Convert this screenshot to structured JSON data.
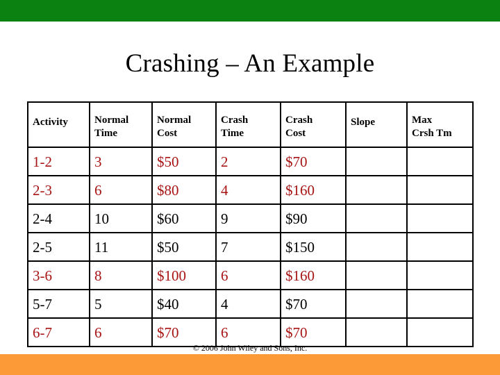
{
  "slide": {
    "title": "Crashing – An Example",
    "copyright": "© 2006 John Wiley and Sons, Inc.",
    "colors": {
      "top_bar": "#0a8111",
      "bottom_bar": "#fd9a38",
      "highlight_text": "#a81414",
      "normal_text": "#000000",
      "background": "#ffffff"
    }
  },
  "table": {
    "headers": [
      {
        "line1": "Activity",
        "line2": "",
        "style": "one-line"
      },
      {
        "line1": "Normal",
        "line2": "Time",
        "style": "two-line"
      },
      {
        "line1": "Normal",
        "line2": "Cost",
        "style": "two-line"
      },
      {
        "line1": "Crash",
        "line2": "Time",
        "style": "two-line"
      },
      {
        "line1": "Crash",
        "line2": "Cost",
        "style": "two-line"
      },
      {
        "line1": "Slope",
        "line2": "",
        "style": "one-line"
      },
      {
        "line1": "Max",
        "line2": "Crsh Tm",
        "style": "two-line"
      }
    ],
    "rows": [
      {
        "activity": "1-2",
        "normal_time": "3",
        "normal_cost": "$50",
        "crash_time": "2",
        "crash_cost": "$70",
        "slope": "",
        "max_crsh_tm": "",
        "color": "red"
      },
      {
        "activity": "2-3",
        "normal_time": "6",
        "normal_cost": "$80",
        "crash_time": "4",
        "crash_cost": "$160",
        "slope": "",
        "max_crsh_tm": "",
        "color": "red"
      },
      {
        "activity": "2-4",
        "normal_time": "10",
        "normal_cost": "$60",
        "crash_time": "9",
        "crash_cost": "$90",
        "slope": "",
        "max_crsh_tm": "",
        "color": "black"
      },
      {
        "activity": "2-5",
        "normal_time": "11",
        "normal_cost": "$50",
        "crash_time": "7",
        "crash_cost": "$150",
        "slope": "",
        "max_crsh_tm": "",
        "color": "black"
      },
      {
        "activity": "3-6",
        "normal_time": "8",
        "normal_cost": "$100",
        "crash_time": "6",
        "crash_cost": "$160",
        "slope": "",
        "max_crsh_tm": "",
        "color": "red"
      },
      {
        "activity": "5-7",
        "normal_time": "5",
        "normal_cost": "$40",
        "crash_time": "4",
        "crash_cost": "$70",
        "slope": "",
        "max_crsh_tm": "",
        "color": "black"
      },
      {
        "activity": "6-7",
        "normal_time": "6",
        "normal_cost": "$70",
        "crash_time": "6",
        "crash_cost": "$70",
        "slope": "",
        "max_crsh_tm": "",
        "color": "red"
      }
    ]
  }
}
